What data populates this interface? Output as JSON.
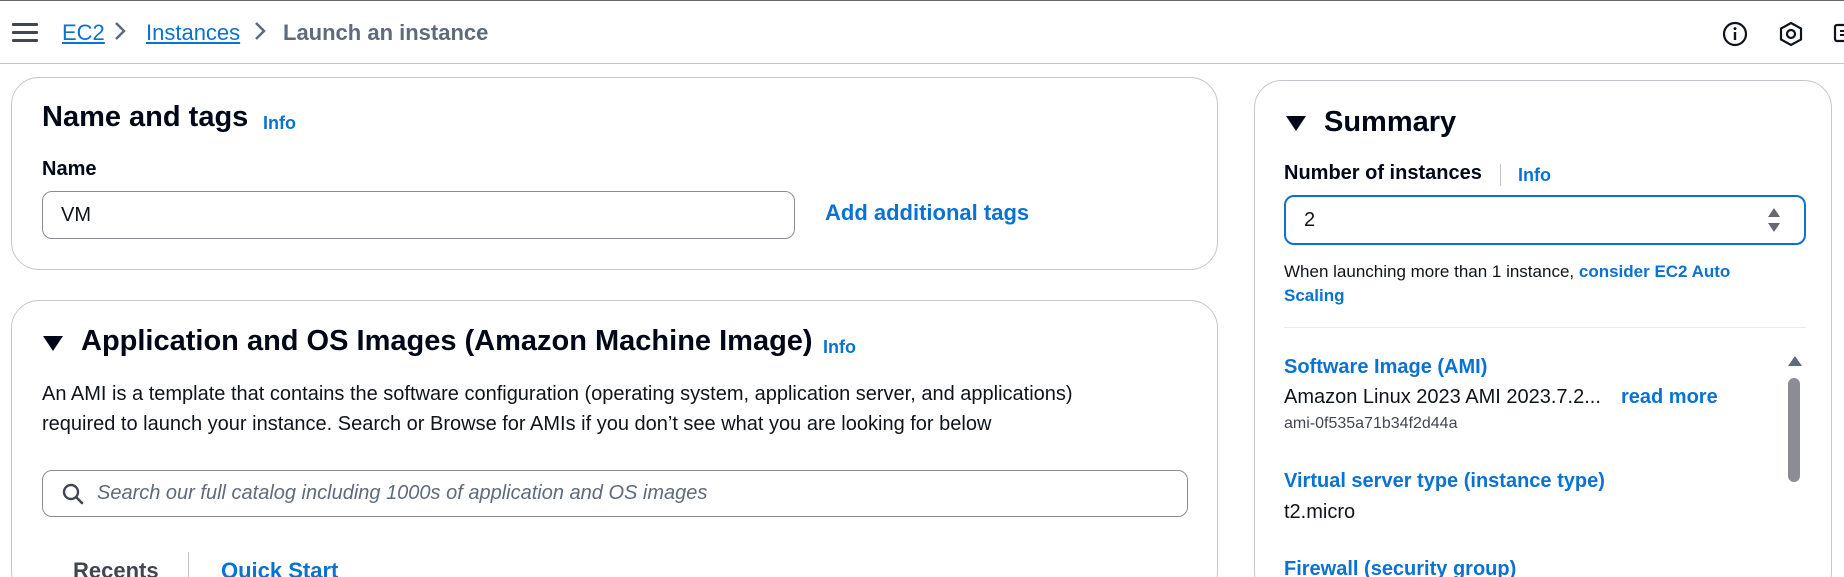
{
  "breadcrumb": {
    "items": [
      {
        "label": "EC2"
      },
      {
        "label": "Instances"
      },
      {
        "label": "Launch an instance"
      }
    ]
  },
  "topbar_icons": [
    "info-icon",
    "settings-hexagon-icon",
    "feedback-icon"
  ],
  "name_and_tags": {
    "title": "Name and tags",
    "info": "Info",
    "name_label": "Name",
    "name_value": "VM",
    "add_tags": "Add additional tags"
  },
  "ami": {
    "title": "Application and OS Images (Amazon Machine Image)",
    "info": "Info",
    "description_line1": "An AMI is a template that contains the software configuration (operating system, application server, and applications)",
    "description_line2": "required to launch your instance. Search or Browse for AMIs if you don’t see what you are looking for below",
    "search_placeholder": "Search our full catalog including 1000s of application and OS images",
    "tabs": [
      {
        "label": "Recents"
      },
      {
        "label": "Quick Start"
      }
    ]
  },
  "summary": {
    "title": "Summary",
    "num_instances_label": "Number of instances",
    "info": "Info",
    "num_instances_value": "2",
    "hint_text": "When launching more than 1 instance,",
    "hint_link_line1": "consider EC2 Auto",
    "hint_link_line2": "Scaling",
    "software_image_label": "Software Image (AMI)",
    "software_image_value": "Amazon Linux 2023 AMI 2023.7.2...",
    "read_more": "read more",
    "ami_id": "ami-0f535a71b34f2d44a",
    "instance_type_label": "Virtual server type (instance type)",
    "instance_type_value": "t2.micro",
    "firewall_label": "Firewall (security group)"
  },
  "colors": {
    "link": "#0972d3",
    "text": "#0f141a",
    "border": "#8c8c94",
    "focus": "#0972d3"
  }
}
